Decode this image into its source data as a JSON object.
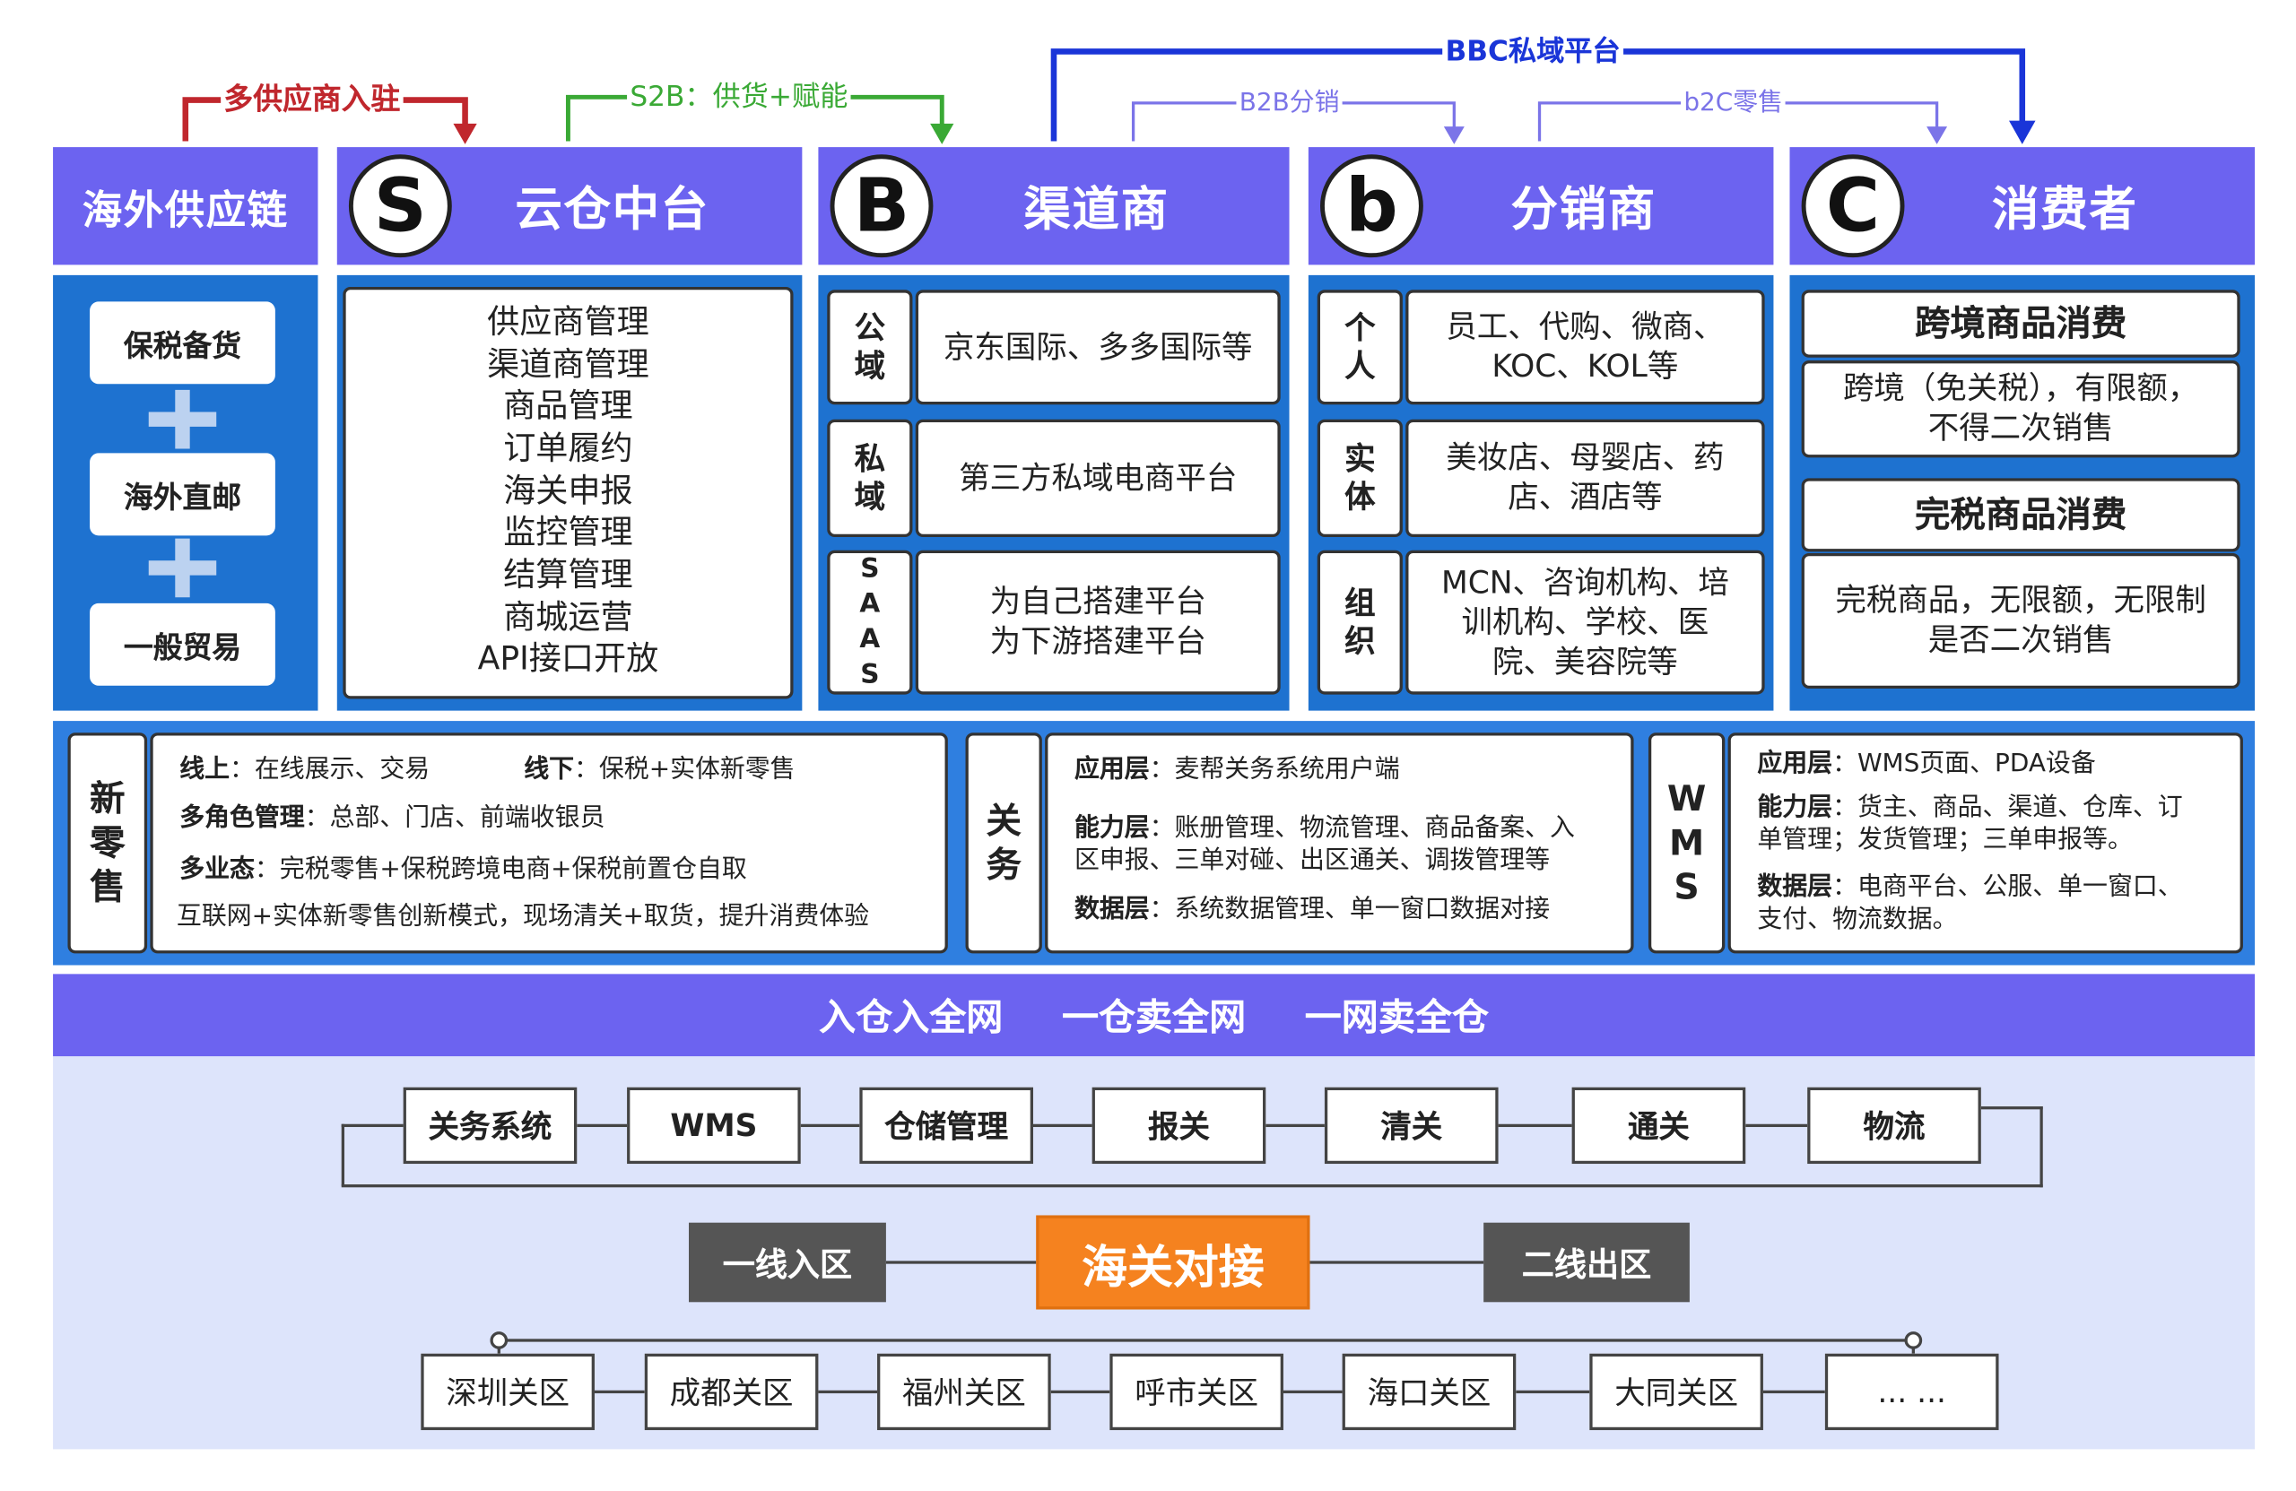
{
  "top_flows": {
    "supplier_entry": "多供应商入驻",
    "s2b": "S2B：供货+赋能",
    "bbc": "BBC私域平台",
    "b2b": "B2B分销",
    "b2c": "b2C零售"
  },
  "columns": {
    "overseas": {
      "title": "海外供应链",
      "items": [
        "保税备货",
        "海外直邮",
        "一般贸易"
      ]
    },
    "cloud": {
      "letter": "S",
      "title": "云仓中台",
      "items": [
        "供应商管理",
        "渠道商管理",
        "商品管理",
        "订单履约",
        "海关申报",
        "监控管理",
        "结算管理",
        "商城运营",
        "API接口开放"
      ]
    },
    "channel": {
      "letter": "B",
      "title": "渠道商",
      "rows": [
        {
          "label": [
            "公",
            "域"
          ],
          "text": "京东国际、多多国际等"
        },
        {
          "label": [
            "私",
            "域"
          ],
          "text": "第三方私域电商平台"
        },
        {
          "label": [
            "S",
            "A",
            "A",
            "S"
          ],
          "text": "为自己搭建平台\n为下游搭建平台"
        }
      ]
    },
    "distributor": {
      "letter": "b",
      "title": "分销商",
      "rows": [
        {
          "label": [
            "个",
            "人"
          ],
          "text": "员工、代购、微商、\nKOC、KOL等"
        },
        {
          "label": [
            "实",
            "体"
          ],
          "text": "美妆店、母婴店、药\n店、酒店等"
        },
        {
          "label": [
            "组",
            "织"
          ],
          "text": "MCN、咨询机构、培\n训机构、学校、医\n院、美容院等"
        }
      ]
    },
    "consumer": {
      "letter": "C",
      "title": "消费者",
      "blocks": [
        {
          "heading": "跨境商品消费",
          "text": "跨境（免关税），有限额，\n不得二次销售"
        },
        {
          "heading": "完税商品消费",
          "text": "完税商品，无限额，无限制\n是否二次销售"
        }
      ]
    }
  },
  "middle": {
    "retail": {
      "label": [
        "新",
        "零",
        "售"
      ],
      "online_k": "线上",
      "online_v": "：在线展示、交易",
      "offline_k": "线下",
      "offline_v": "：保税+实体新零售",
      "roles_k": "多角色管理",
      "roles_v": "：总部、门店、前端收银员",
      "biz_k": "多业态",
      "biz_v": "：完税零售+保税跨境电商+保税前置仓自取",
      "summary": "互联网+实体新零售创新模式，现场清关+取货，提升消费体验"
    },
    "customs": {
      "label": [
        "关",
        "务"
      ],
      "app_k": "应用层",
      "app_v": "：麦帮关务系统用户端",
      "cap_k": "能力层",
      "cap_v1": "：账册管理、物流管理、商品备案、入",
      "cap_v2": "区申报、三单对碰、出区通关、调拨管理等",
      "data_k": "数据层",
      "data_v": "：系统数据管理、单一窗口数据对接"
    },
    "wms": {
      "label": [
        "W",
        "M",
        "S"
      ],
      "app_k": "应用层",
      "app_v": "：WMS页面、PDA设备",
      "cap_k": "能力层",
      "cap_v1": "：货主、商品、渠道、仓库、订",
      "cap_v2": "单管理；发货管理；三单申报等。",
      "data_k": "数据层",
      "data_v1": "：电商平台、公服、单一窗口、",
      "data_v2": "支付、物流数据。"
    }
  },
  "bottom": {
    "slogans": [
      "入仓入全网",
      "一仓卖全网",
      "一网卖全仓"
    ],
    "chain": [
      "关务系统",
      "WMS",
      "仓储管理",
      "报关",
      "清关",
      "通关",
      "物流"
    ],
    "left_zone": "一线入区",
    "center": "海关对接",
    "right_zone": "二线出区",
    "zones": [
      "深圳关区",
      "成都关区",
      "福州关区",
      "呼市关区",
      "海口关区",
      "大同关区",
      "... ..."
    ]
  },
  "colors": {
    "header_purple": "#6c63f0",
    "panel_blue": "#1e72d0",
    "band_blue": "#2f7fe0",
    "bottom_bg": "#dde4fb",
    "orange": "#f5821f",
    "dark_gray": "#555555",
    "red_arrow": "#c0272d",
    "green_arrow": "#3aa935",
    "blue_arrow": "#1a35d8",
    "light_purple_arrow": "#7b74e8"
  }
}
